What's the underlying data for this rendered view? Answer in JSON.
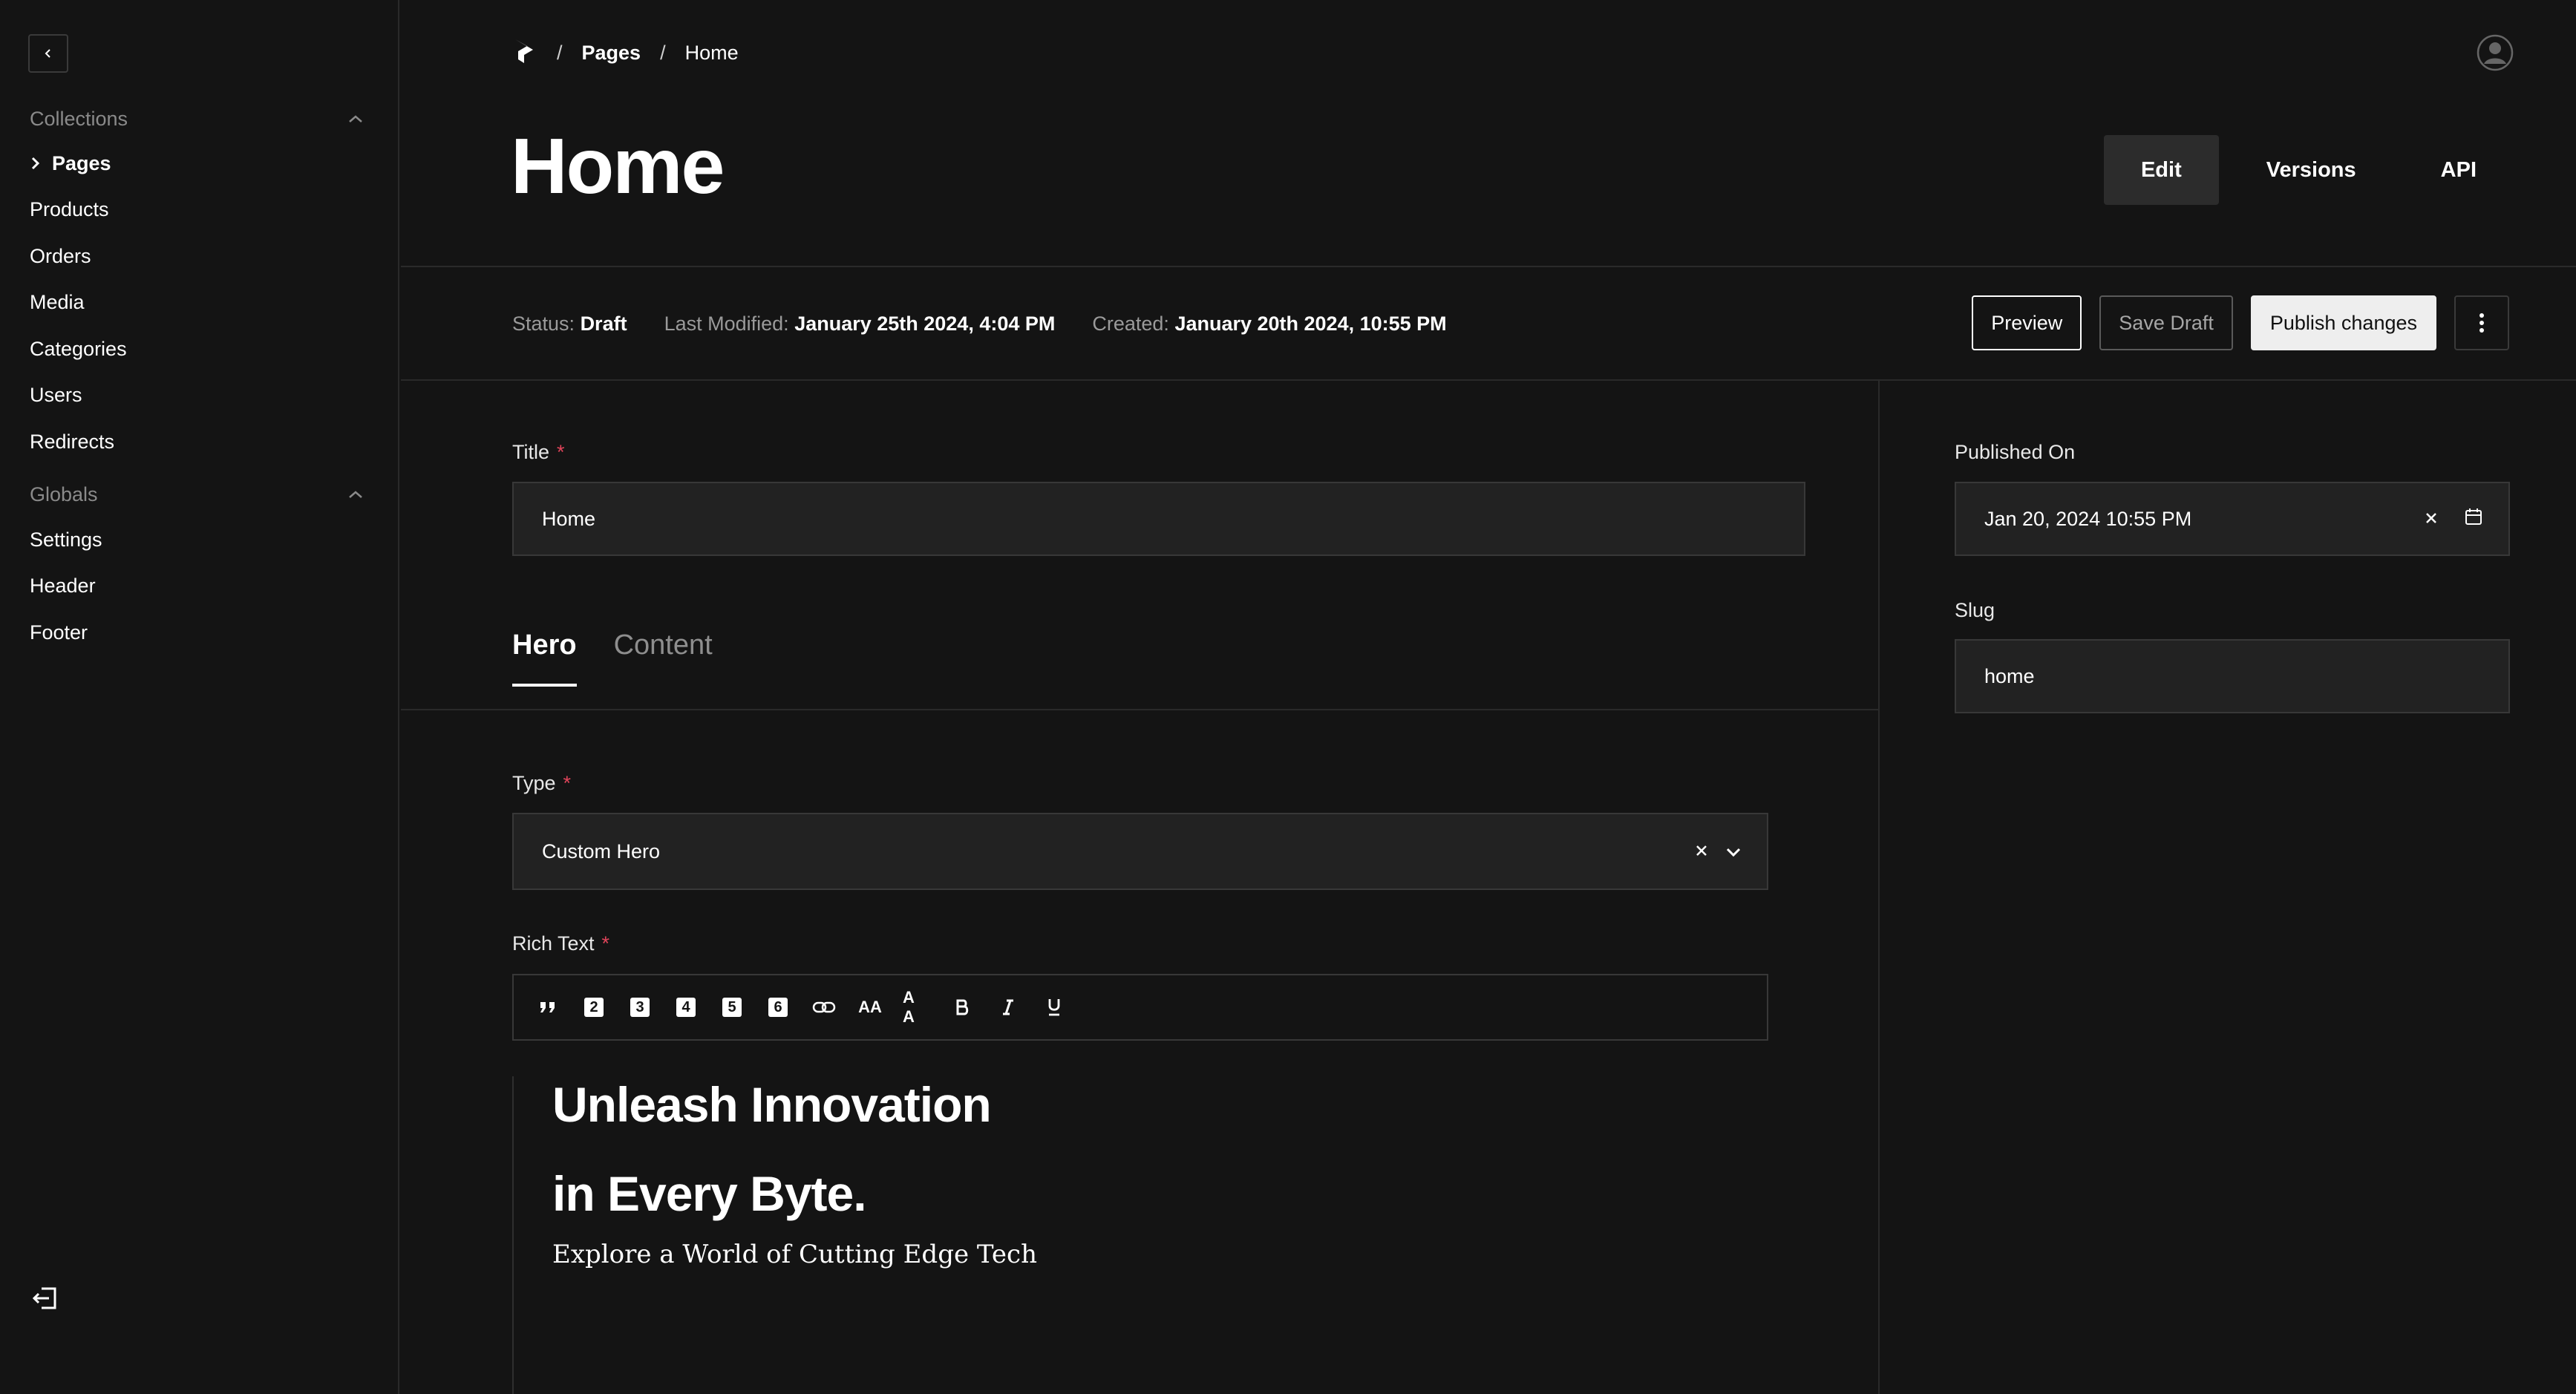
{
  "sidebar": {
    "collections_header": "Collections",
    "collections": [
      {
        "label": "Pages",
        "active": true
      },
      {
        "label": "Products"
      },
      {
        "label": "Orders"
      },
      {
        "label": "Media"
      },
      {
        "label": "Categories"
      },
      {
        "label": "Users"
      },
      {
        "label": "Redirects"
      }
    ],
    "globals_header": "Globals",
    "globals": [
      {
        "label": "Settings"
      },
      {
        "label": "Header"
      },
      {
        "label": "Footer"
      }
    ]
  },
  "breadcrumb": {
    "sep": "/",
    "pages": "Pages",
    "current": "Home"
  },
  "page": {
    "title": "Home"
  },
  "view_tabs": [
    "Edit",
    "Versions",
    "API"
  ],
  "meta": {
    "status_label": "Status:",
    "status_value": "Draft",
    "modified_label": "Last Modified:",
    "modified_value": "January 25th 2024, 4:04 PM",
    "created_label": "Created:",
    "created_value": "January 20th 2024, 10:55 PM"
  },
  "actions": {
    "preview": "Preview",
    "save_draft": "Save Draft",
    "publish": "Publish changes"
  },
  "form": {
    "title_label": "Title",
    "title_value": "Home",
    "required_mark": "*",
    "tabs": [
      "Hero",
      "Content"
    ],
    "type_label": "Type",
    "type_value": "Custom Hero",
    "rich_text_label": "Rich Text",
    "toolbar_badges": [
      "2",
      "3",
      "4",
      "5",
      "6"
    ],
    "toolbar_small_caps": "AA",
    "toolbar_caps": "A A",
    "editor": {
      "line1": "Unleash Innovation",
      "line2": "in Every Byte.",
      "lead": "Explore a World of Cutting Edge Tech"
    }
  },
  "side": {
    "published_label": "Published On",
    "published_value": "Jan 20, 2024 10:55 PM",
    "slug_label": "Slug",
    "slug_value": "home"
  },
  "colors": {
    "background": "#141414",
    "required": "#e0445a",
    "publish_bg": "#eeeeee"
  }
}
